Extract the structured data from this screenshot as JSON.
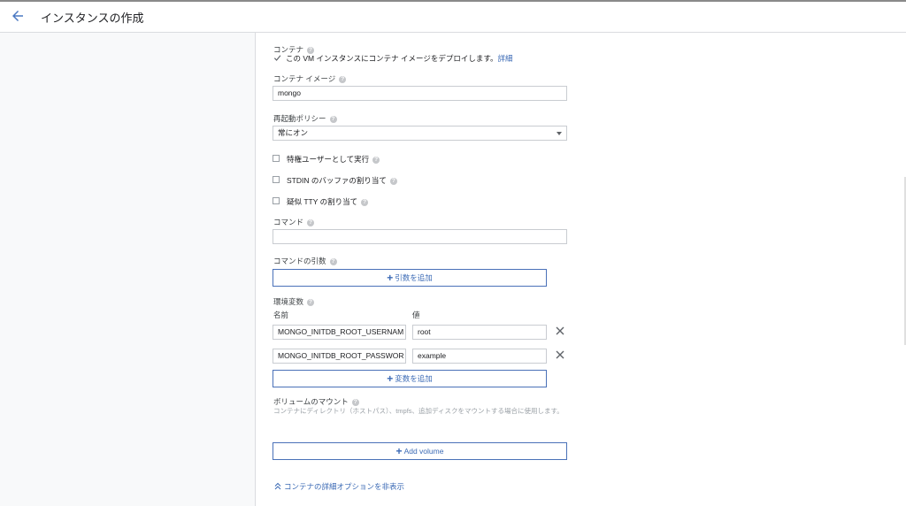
{
  "header": {
    "title": "インスタンスの作成"
  },
  "container": {
    "section_label": "コンテナ",
    "deploy_checkbox_label": "この VM インスタンスにコンテナ イメージをデプロイします。",
    "deploy_link": "詳細",
    "image_label": "コンテナ イメージ",
    "image_value": "mongo",
    "restart_label": "再起動ポリシー",
    "restart_value": "常にオン",
    "privileged_label": "特権ユーザーとして実行",
    "stdin_label": "STDIN のバッファの割り当て",
    "tty_label": "疑似 TTY の割り当て",
    "command_label": "コマンド",
    "command_value": "",
    "args_label": "コマンドの引数",
    "add_arg_label": "引数を追加",
    "env_label": "環境変数",
    "env_name_header": "名前",
    "env_value_header": "値",
    "env_vars": [
      {
        "name": "MONGO_INITDB_ROOT_USERNAM",
        "value": "root"
      },
      {
        "name": "MONGO_INITDB_ROOT_PASSWOR",
        "value": "example"
      }
    ],
    "add_var_label": "変数を追加",
    "volume_label": "ボリュームのマウント",
    "volume_desc": "コンテナにディレクトリ（ホストパス）、tmpfs、追加ディスクをマウントする場合に使用します。",
    "add_volume_label": "Add volume",
    "hide_advanced_label": "コンテナの詳細オプションを非表示"
  },
  "colors": {
    "accent": "#3b6ab5",
    "border": "#c9ccd1",
    "panel": "#f8f9fa"
  },
  "icons": [
    "arrow-back-icon",
    "help-icon",
    "checkmark-icon",
    "dropdown-caret-icon",
    "plus-icon",
    "close-icon",
    "chevron-up-double-icon"
  ]
}
